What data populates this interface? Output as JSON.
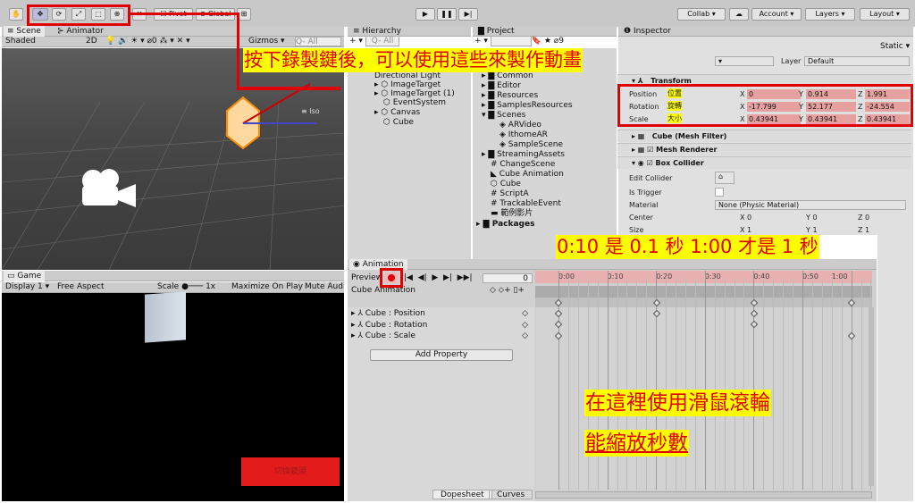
{
  "toolbar": {
    "tools": [
      "✋",
      "✥",
      "⟳",
      "⤢",
      "⬚",
      "⊕",
      "✕"
    ],
    "pivot": "Pivot",
    "global": "Global",
    "collab": "Collab ▾",
    "account": "Account",
    "layers": "Layers",
    "layout": "Layout"
  },
  "scene": {
    "tab": "Scene",
    "tab2": "Animator",
    "shaded": "Shaded",
    "twod": "2D",
    "gizmos": "Gizmos",
    "search": "All",
    "iso": "≡ Iso"
  },
  "game": {
    "tab": "Game",
    "display": "Display 1",
    "aspect": "Free Aspect",
    "scale_label": "Scale",
    "scale_value": "1x",
    "maximize": "Maximize On Play",
    "mute": "Mute Audio",
    "switch_button": "切換鏡頭"
  },
  "hierarchy": {
    "tab": "Hierarchy",
    "search": "All",
    "items": [
      "Directional Light",
      "ImageTarget",
      "ImageTarget (1)",
      "EventSystem",
      "Canvas",
      "Cube"
    ]
  },
  "project": {
    "tab": "Project",
    "items": [
      "Common",
      "Editor",
      "Resources",
      "SamplesResources",
      "Scenes",
      "ARVideo",
      "IthomeAR",
      "SampleScene",
      "StreamingAssets",
      "ChangeScene",
      "Cube Animation",
      "Cube",
      "ScriptA",
      "TrackableEvent",
      "範例影片",
      "Packages"
    ]
  },
  "inspector": {
    "tab": "Inspector",
    "static": "Static ▾",
    "layer_label": "Layer",
    "layer_value": "Default",
    "transform": "Transform",
    "position_label": "Position",
    "rotation_label": "Rotation",
    "scale_label": "Scale",
    "position_note": "位置",
    "rotation_note": "旋轉",
    "scale_note": "大小",
    "position": {
      "x": "0",
      "y": "0.914",
      "z": "1.991"
    },
    "rotation": {
      "x": "-17.799",
      "y": "52.177",
      "z": "-24.554"
    },
    "scale": {
      "x": "0.43941",
      "y": "0.43941",
      "z": "0.43941"
    },
    "mesh_filter": "Cube (Mesh Filter)",
    "mesh_renderer": "Mesh Renderer",
    "box_collider": "Box Collider",
    "edit_collider": "Edit Collider",
    "is_trigger": "Is Trigger",
    "material_label": "Material",
    "material_value": "None (Physic Material)",
    "center_label": "Center",
    "center": {
      "x": "0",
      "y": "0",
      "z": "0"
    },
    "size_label": "Size",
    "size": {
      "x": "1",
      "y": "1",
      "z": "1"
    }
  },
  "animation": {
    "tab": "Animation",
    "preview": "Preview",
    "frame": "0",
    "clip": "Cube Animation",
    "properties": [
      "Cube : Position",
      "Cube : Rotation",
      "Cube : Scale"
    ],
    "add_property": "Add Property",
    "dopesheet": "Dopesheet",
    "curves": "Curves",
    "times": [
      "0:00",
      "0:10",
      "0:20",
      "0:30",
      "0:40",
      "0:50",
      "1:00"
    ]
  },
  "annotations": {
    "record_note": "按下錄製鍵後，可以使用這些來製作動畫",
    "time_note": "0:10 是 0.1 秒 1:00 才是 1 秒",
    "wheel_note_1": "在這裡使用滑鼠滾輪",
    "wheel_note_2": "能縮放秒數"
  },
  "colors": {
    "highlight": "#e00000",
    "annotation_bg": "#ffff00",
    "record": "#e00000"
  }
}
